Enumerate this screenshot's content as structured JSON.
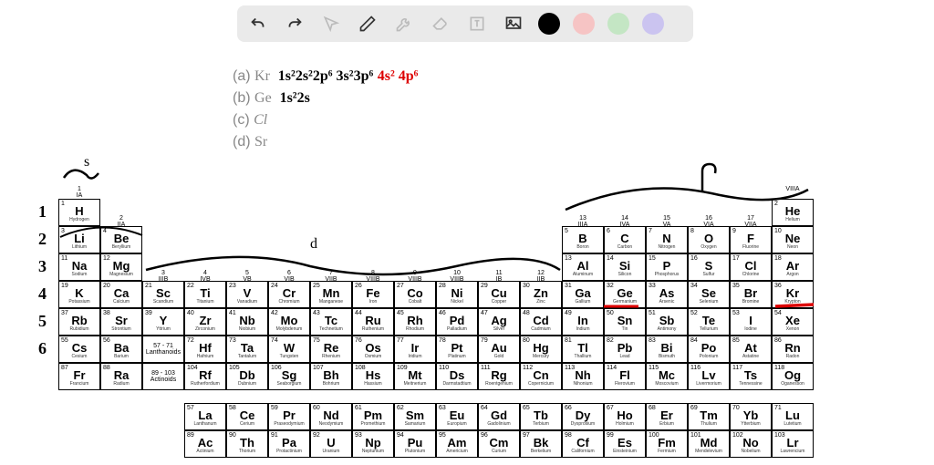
{
  "toolbar": {
    "colors": {
      "black": "#000000",
      "pink": "#f6c4c4",
      "green": "#c4e6c4",
      "purple": "#cbc4f0"
    }
  },
  "questions": {
    "a": {
      "label": "(a)",
      "sym": "Kr",
      "work_black": "1s²2s²2p⁶ 3s²3p⁶",
      "work_red": " 4s² 4p⁶"
    },
    "b": {
      "label": "(b)",
      "sym": "Ge",
      "work_black": "1s²2s"
    },
    "c": {
      "label": "(c)",
      "sym": "Cl"
    },
    "d": {
      "label": "(d)",
      "sym": "Sr"
    }
  },
  "row_numbers": [
    "1",
    "2",
    "3",
    "4",
    "5",
    "6"
  ],
  "group_labels": {
    "g1": {
      "n": "1",
      "r": "IA"
    },
    "g2": {
      "n": "2",
      "r": "IIA"
    },
    "g3": {
      "n": "3",
      "r": "IIIB"
    },
    "g4": {
      "n": "4",
      "r": "IVB"
    },
    "g5": {
      "n": "5",
      "r": "VB"
    },
    "g6": {
      "n": "6",
      "r": "VIB"
    },
    "g7": {
      "n": "7",
      "r": "VIIB"
    },
    "g8": {
      "n": "8",
      "r": "VIIIB"
    },
    "g9": {
      "n": "9",
      "r": "VIIIB"
    },
    "g10": {
      "n": "10",
      "r": "VIIIB"
    },
    "g11": {
      "n": "11",
      "r": "IB"
    },
    "g12": {
      "n": "12",
      "r": "IIB"
    },
    "g13": {
      "n": "13",
      "r": "IIIA"
    },
    "g14": {
      "n": "14",
      "r": "IVA"
    },
    "g15": {
      "n": "15",
      "r": "VA"
    },
    "g16": {
      "n": "16",
      "r": "VIA"
    },
    "g17": {
      "n": "17",
      "r": "VIIA"
    },
    "g18": {
      "n": "",
      "r": "VIIIA"
    }
  },
  "elements": [
    [
      "1",
      "H",
      "Hydrogen"
    ],
    null,
    null,
    null,
    null,
    null,
    null,
    null,
    null,
    null,
    null,
    null,
    null,
    null,
    null,
    null,
    null,
    [
      "2",
      "He",
      "Helium"
    ],
    [
      "3",
      "Li",
      "Lithium"
    ],
    [
      "4",
      "Be",
      "Beryllium"
    ],
    null,
    null,
    null,
    null,
    null,
    null,
    null,
    null,
    null,
    null,
    [
      "5",
      "B",
      "Boron"
    ],
    [
      "6",
      "C",
      "Carbon"
    ],
    [
      "7",
      "N",
      "Nitrogen"
    ],
    [
      "8",
      "O",
      "Oxygen"
    ],
    [
      "9",
      "F",
      "Fluorine"
    ],
    [
      "10",
      "Ne",
      "Neon"
    ],
    [
      "11",
      "Na",
      "Sodium"
    ],
    [
      "12",
      "Mg",
      "Magnesium"
    ],
    null,
    null,
    null,
    null,
    null,
    null,
    null,
    null,
    null,
    null,
    [
      "13",
      "Al",
      "Aluminum"
    ],
    [
      "14",
      "Si",
      "Silicon"
    ],
    [
      "15",
      "P",
      "Phosphorus"
    ],
    [
      "16",
      "S",
      "Sulfur"
    ],
    [
      "17",
      "Cl",
      "Chlorine"
    ],
    [
      "18",
      "Ar",
      "Argon"
    ],
    [
      "19",
      "K",
      "Potassium"
    ],
    [
      "20",
      "Ca",
      "Calcium"
    ],
    [
      "21",
      "Sc",
      "Scandium"
    ],
    [
      "22",
      "Ti",
      "Titanium"
    ],
    [
      "23",
      "V",
      "Vanadium"
    ],
    [
      "24",
      "Cr",
      "Chromium"
    ],
    [
      "25",
      "Mn",
      "Manganese"
    ],
    [
      "26",
      "Fe",
      "Iron"
    ],
    [
      "27",
      "Co",
      "Cobalt"
    ],
    [
      "28",
      "Ni",
      "Nickel"
    ],
    [
      "29",
      "Cu",
      "Copper"
    ],
    [
      "30",
      "Zn",
      "Zinc"
    ],
    [
      "31",
      "Ga",
      "Gallium"
    ],
    [
      "32",
      "Ge",
      "Germanium"
    ],
    [
      "33",
      "As",
      "Arsenic"
    ],
    [
      "34",
      "Se",
      "Selenium"
    ],
    [
      "35",
      "Br",
      "Bromine"
    ],
    [
      "36",
      "Kr",
      "Krypton"
    ],
    [
      "37",
      "Rb",
      "Rubidium"
    ],
    [
      "38",
      "Sr",
      "Strontium"
    ],
    [
      "39",
      "Y",
      "Yttrium"
    ],
    [
      "40",
      "Zr",
      "Zirconium"
    ],
    [
      "41",
      "Nb",
      "Niobium"
    ],
    [
      "42",
      "Mo",
      "Molybdenum"
    ],
    [
      "43",
      "Tc",
      "Technetium"
    ],
    [
      "44",
      "Ru",
      "Ruthenium"
    ],
    [
      "45",
      "Rh",
      "Rhodium"
    ],
    [
      "46",
      "Pd",
      "Palladium"
    ],
    [
      "47",
      "Ag",
      "Silver"
    ],
    [
      "48",
      "Cd",
      "Cadmium"
    ],
    [
      "49",
      "In",
      "Indium"
    ],
    [
      "50",
      "Sn",
      "Tin"
    ],
    [
      "51",
      "Sb",
      "Antimony"
    ],
    [
      "52",
      "Te",
      "Tellurium"
    ],
    [
      "53",
      "I",
      "Iodine"
    ],
    [
      "54",
      "Xe",
      "Xenon"
    ],
    [
      "55",
      "Cs",
      "Cesium"
    ],
    [
      "56",
      "Ba",
      "Barium"
    ],
    "L57",
    [
      "72",
      "Hf",
      "Hafnium"
    ],
    [
      "73",
      "Ta",
      "Tantalum"
    ],
    [
      "74",
      "W",
      "Tungsten"
    ],
    [
      "75",
      "Re",
      "Rhenium"
    ],
    [
      "76",
      "Os",
      "Osmium"
    ],
    [
      "77",
      "Ir",
      "Iridium"
    ],
    [
      "78",
      "Pt",
      "Platinum"
    ],
    [
      "79",
      "Au",
      "Gold"
    ],
    [
      "80",
      "Hg",
      "Mercury"
    ],
    [
      "81",
      "Tl",
      "Thallium"
    ],
    [
      "82",
      "Pb",
      "Lead"
    ],
    [
      "83",
      "Bi",
      "Bismuth"
    ],
    [
      "84",
      "Po",
      "Polonium"
    ],
    [
      "85",
      "At",
      "Astatine"
    ],
    [
      "86",
      "Rn",
      "Radon"
    ],
    [
      "87",
      "Fr",
      "Francium"
    ],
    [
      "88",
      "Ra",
      "Radium"
    ],
    "L89",
    [
      "104",
      "Rf",
      "Rutherfordium"
    ],
    [
      "105",
      "Db",
      "Dubnium"
    ],
    [
      "106",
      "Sg",
      "Seaborgium"
    ],
    [
      "107",
      "Bh",
      "Bohrium"
    ],
    [
      "108",
      "Hs",
      "Hassium"
    ],
    [
      "109",
      "Mt",
      "Meitnerium"
    ],
    [
      "110",
      "Ds",
      "Darmstadtium"
    ],
    [
      "111",
      "Rg",
      "Roentgenium"
    ],
    [
      "112",
      "Cn",
      "Copernicium"
    ],
    [
      "113",
      "Nh",
      "Nihonium"
    ],
    [
      "114",
      "Fl",
      "Flerovium"
    ],
    [
      "115",
      "Mc",
      "Moscovium"
    ],
    [
      "116",
      "Lv",
      "Livermorium"
    ],
    [
      "117",
      "Ts",
      "Tennessine"
    ],
    [
      "118",
      "Og",
      "Oganesson"
    ]
  ],
  "lanth_labels": {
    "L57": "57 - 71\nLanthanoids",
    "L89": "89 - 103\nActinoids"
  },
  "fblock": [
    [
      "57",
      "La",
      "Lanthanum"
    ],
    [
      "58",
      "Ce",
      "Cerium"
    ],
    [
      "59",
      "Pr",
      "Praseodymium"
    ],
    [
      "60",
      "Nd",
      "Neodymium"
    ],
    [
      "61",
      "Pm",
      "Promethium"
    ],
    [
      "62",
      "Sm",
      "Samarium"
    ],
    [
      "63",
      "Eu",
      "Europium"
    ],
    [
      "64",
      "Gd",
      "Gadolinium"
    ],
    [
      "65",
      "Tb",
      "Terbium"
    ],
    [
      "66",
      "Dy",
      "Dysprosium"
    ],
    [
      "67",
      "Ho",
      "Holmium"
    ],
    [
      "68",
      "Er",
      "Erbium"
    ],
    [
      "69",
      "Tm",
      "Thulium"
    ],
    [
      "70",
      "Yb",
      "Ytterbium"
    ],
    [
      "71",
      "Lu",
      "Lutetium"
    ],
    [
      "89",
      "Ac",
      "Actinium"
    ],
    [
      "90",
      "Th",
      "Thorium"
    ],
    [
      "91",
      "Pa",
      "Protactinium"
    ],
    [
      "92",
      "U",
      "Uranium"
    ],
    [
      "93",
      "Np",
      "Neptunium"
    ],
    [
      "94",
      "Pu",
      "Plutonium"
    ],
    [
      "95",
      "Am",
      "Americium"
    ],
    [
      "96",
      "Cm",
      "Curium"
    ],
    [
      "97",
      "Bk",
      "Berkelium"
    ],
    [
      "98",
      "Cf",
      "Californium"
    ],
    [
      "99",
      "Es",
      "Einsteinium"
    ],
    [
      "100",
      "Fm",
      "Fermium"
    ],
    [
      "101",
      "Md",
      "Mendelevium"
    ],
    [
      "102",
      "No",
      "Nobelium"
    ],
    [
      "103",
      "Lr",
      "Lawrencium"
    ]
  ],
  "annotations": {
    "s_label": "s",
    "d_label": "d",
    "p_label": "P"
  }
}
